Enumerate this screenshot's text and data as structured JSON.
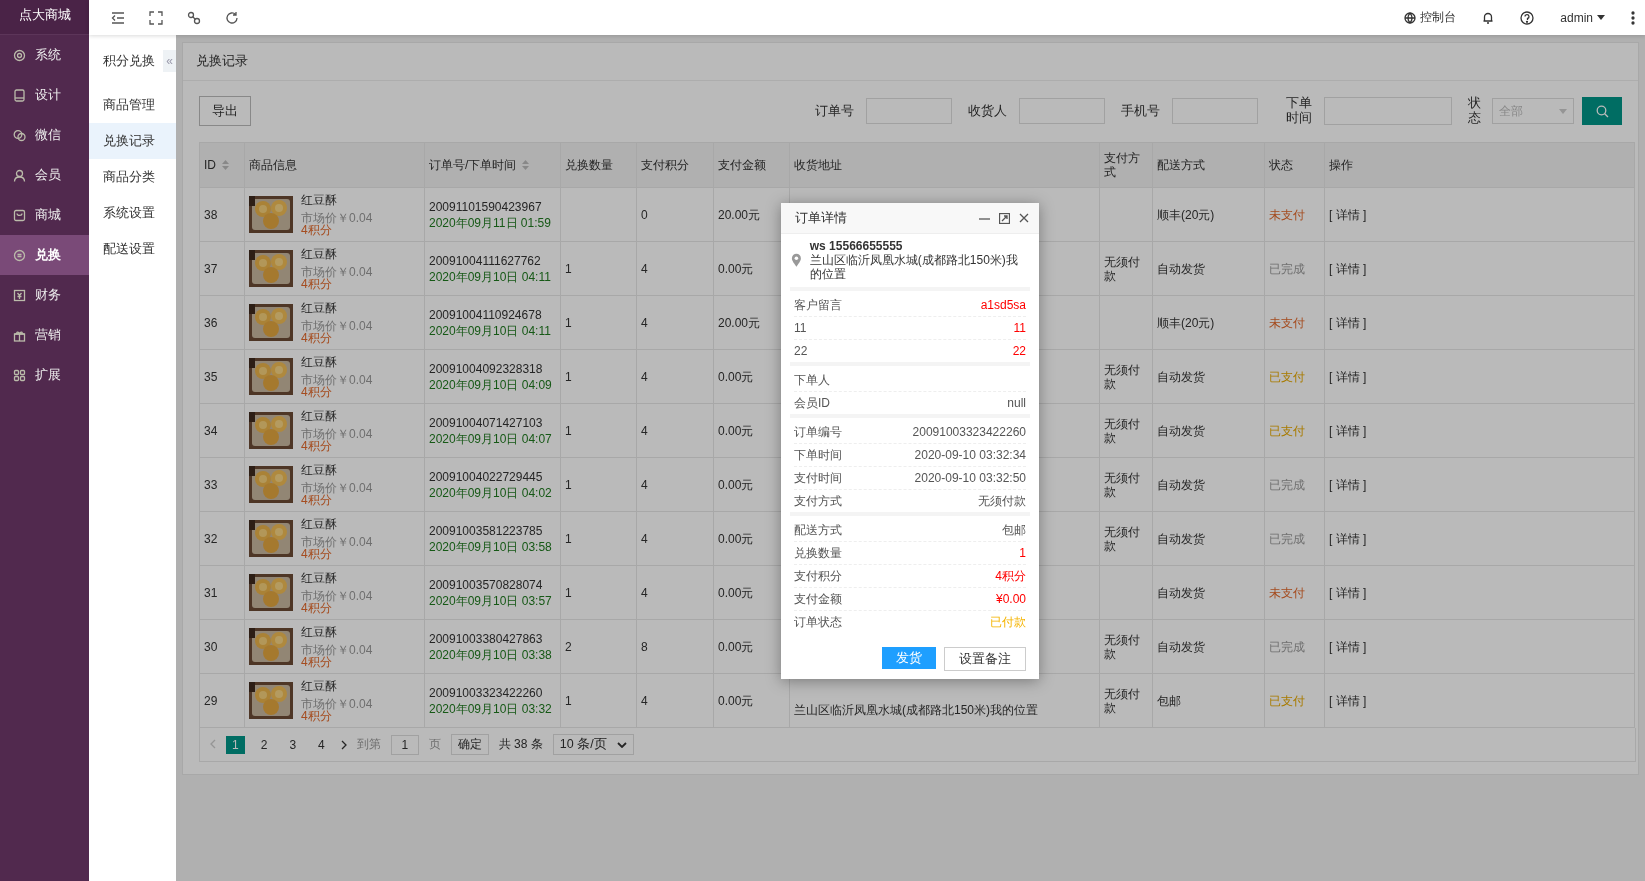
{
  "sidebar": {
    "logo": "点大商城",
    "items": [
      {
        "label": "系统",
        "selected": false
      },
      {
        "label": "设计",
        "selected": false
      },
      {
        "label": "微信",
        "selected": false
      },
      {
        "label": "会员",
        "selected": false
      },
      {
        "label": "商城",
        "selected": false
      },
      {
        "label": "兑换",
        "selected": true
      },
      {
        "label": "财务",
        "selected": false
      },
      {
        "label": "营销",
        "selected": false
      },
      {
        "label": "扩展",
        "selected": false
      }
    ]
  },
  "top_bar": {
    "console": "控制台",
    "user": "admin"
  },
  "subnav": {
    "title": "积分兑换",
    "collapse": "«",
    "items": [
      {
        "label": "商品管理",
        "selected": false
      },
      {
        "label": "兑换记录",
        "selected": true
      },
      {
        "label": "商品分类",
        "selected": false
      },
      {
        "label": "系统设置",
        "selected": false
      },
      {
        "label": "配送设置",
        "selected": false
      }
    ]
  },
  "panel": {
    "title": "兑换记录",
    "export": "导出",
    "filters": [
      {
        "label": "订单号",
        "kind": "text"
      },
      {
        "label": "收货人",
        "kind": "text"
      },
      {
        "label": "手机号",
        "kind": "text"
      },
      {
        "label": "下单时间",
        "kind": "date"
      },
      {
        "label": "状态",
        "kind": "select",
        "placeholder": "全部"
      }
    ]
  },
  "table": {
    "columns": [
      {
        "label": "ID",
        "sortable": true
      },
      {
        "label": "商品信息",
        "sortable": false
      },
      {
        "label": "订单号/下单时间",
        "sortable": true
      },
      {
        "label": "兑换数量",
        "sortable": false
      },
      {
        "label": "支付积分",
        "sortable": false
      },
      {
        "label": "支付金额",
        "sortable": false
      },
      {
        "label": "收货地址",
        "sortable": false
      },
      {
        "label": "支付方式",
        "sortable": false
      },
      {
        "label": "配送方式",
        "sortable": false
      },
      {
        "label": "状态",
        "sortable": false
      },
      {
        "label": "操作",
        "sortable": false
      }
    ],
    "rows": [
      {
        "id": "38",
        "product": "红豆酥",
        "market_price": "市场价￥0.04",
        "points": "4积分",
        "order_no": "20091101590423967",
        "time": "2020年09月11日 01:59",
        "quantity": "",
        "paid_points": "0",
        "amount": "20.00元",
        "address": "",
        "pay_method": "",
        "delivery": "顺丰(20元)",
        "status": "未支付",
        "kind": "unpaid",
        "action": "[ 详情 ]"
      },
      {
        "id": "37",
        "product": "红豆酥",
        "market_price": "市场价￥0.04",
        "points": "4积分",
        "order_no": "20091004111627762",
        "time": "2020年09月10日 04:11",
        "quantity": "1",
        "paid_points": "4",
        "amount": "0.00元",
        "address": "",
        "pay_method": "无须付款",
        "delivery": "自动发货",
        "status": "已完成",
        "kind": "done",
        "action": "[ 详情 ]"
      },
      {
        "id": "36",
        "product": "红豆酥",
        "market_price": "市场价￥0.04",
        "points": "4积分",
        "order_no": "20091004110924678",
        "time": "2020年09月10日 04:11",
        "quantity": "1",
        "paid_points": "4",
        "amount": "20.00元",
        "address": "",
        "pay_method": "",
        "delivery": "顺丰(20元)",
        "status": "未支付",
        "kind": "unpaid",
        "action": "[ 详情 ]"
      },
      {
        "id": "35",
        "product": "红豆酥",
        "market_price": "市场价￥0.04",
        "points": "4积分",
        "order_no": "20091004092328318",
        "time": "2020年09月10日 04:09",
        "quantity": "1",
        "paid_points": "4",
        "amount": "0.00元",
        "address": "",
        "pay_method": "无须付款",
        "delivery": "自动发货",
        "status": "已支付",
        "kind": "paid",
        "action": "[ 详情 ]"
      },
      {
        "id": "34",
        "product": "红豆酥",
        "market_price": "市场价￥0.04",
        "points": "4积分",
        "order_no": "20091004071427103",
        "time": "2020年09月10日 04:07",
        "quantity": "1",
        "paid_points": "4",
        "amount": "0.00元",
        "address": "",
        "pay_method": "无须付款",
        "delivery": "自动发货",
        "status": "已支付",
        "kind": "paid",
        "action": "[ 详情 ]"
      },
      {
        "id": "33",
        "product": "红豆酥",
        "market_price": "市场价￥0.04",
        "points": "4积分",
        "order_no": "20091004022729445",
        "time": "2020年09月10日 04:02",
        "quantity": "1",
        "paid_points": "4",
        "amount": "0.00元",
        "address": "",
        "pay_method": "无须付款",
        "delivery": "自动发货",
        "status": "已完成",
        "kind": "done",
        "action": "[ 详情 ]"
      },
      {
        "id": "32",
        "product": "红豆酥",
        "market_price": "市场价￥0.04",
        "points": "4积分",
        "order_no": "20091003581223785",
        "time": "2020年09月10日 03:58",
        "quantity": "1",
        "paid_points": "4",
        "amount": "0.00元",
        "address": "",
        "pay_method": "无须付款",
        "delivery": "自动发货",
        "status": "已完成",
        "kind": "done",
        "action": "[ 详情 ]"
      },
      {
        "id": "31",
        "product": "红豆酥",
        "market_price": "市场价￥0.04",
        "points": "4积分",
        "order_no": "20091003570828074",
        "time": "2020年09月10日 03:57",
        "quantity": "1",
        "paid_points": "4",
        "amount": "0.00元",
        "address": "",
        "pay_method": "",
        "delivery": "自动发货",
        "status": "未支付",
        "kind": "unpaid",
        "action": "[ 详情 ]"
      },
      {
        "id": "30",
        "product": "红豆酥",
        "market_price": "市场价￥0.04",
        "points": "4积分",
        "order_no": "20091003380427863",
        "time": "2020年09月10日 03:38",
        "quantity": "2",
        "paid_points": "8",
        "amount": "0.00元",
        "address": "",
        "pay_method": "无须付款",
        "delivery": "自动发货",
        "status": "已完成",
        "kind": "done",
        "action": "[ 详情 ]"
      },
      {
        "id": "29",
        "product": "红豆酥",
        "market_price": "市场价￥0.04",
        "points": "4积分",
        "order_no": "20091003323422260",
        "time": "2020年09月10日 03:32",
        "quantity": "1",
        "paid_points": "4",
        "amount": "0.00元",
        "address": "兰山区临沂凤凰水城(成都路北150米)我的位置",
        "pay_method": "无须付款",
        "delivery": "包邮",
        "status": "已支付",
        "kind": "paid",
        "action": "[ 详情 ]"
      }
    ]
  },
  "pagination": {
    "prev_disabled": true,
    "pages": [
      {
        "label": "1",
        "selected": true
      },
      {
        "label": "2",
        "selected": false
      },
      {
        "label": "3",
        "selected": false
      },
      {
        "label": "4",
        "selected": false
      }
    ],
    "goto": "到第",
    "page_value": "1",
    "page_unit": "页",
    "confirm": "确定",
    "total": "共 38 条",
    "page_size": "10 条/页"
  },
  "modal": {
    "title": "订单详情",
    "contact": "ws 15566655555",
    "address": "兰山区临沂凤凰水城(成都路北150米)我的位置",
    "sections": [
      [
        {
          "label": "客户留言",
          "value": "a1sd5sa",
          "kind": "alert"
        },
        {
          "label": "11",
          "value": "11",
          "kind": "alert"
        },
        {
          "label": "22",
          "value": "22",
          "kind": "alert"
        }
      ],
      [
        {
          "label": "下单人"
        },
        {
          "label": "会员ID",
          "value": "null",
          "kind": "plain"
        }
      ],
      [
        {
          "label": "订单编号",
          "value": "20091003323422260",
          "kind": "plain"
        },
        {
          "label": "下单时间",
          "value": "2020-09-10 03:32:34",
          "kind": "plain"
        },
        {
          "label": "支付时间",
          "value": "2020-09-10 03:32:50",
          "kind": "plain"
        },
        {
          "label": "支付方式",
          "value": "无须付款",
          "kind": "plain"
        }
      ],
      [
        {
          "label": "配送方式",
          "value": "包邮",
          "kind": "plain"
        },
        {
          "label": "兑换数量",
          "value": "1",
          "kind": "alert"
        },
        {
          "label": "支付积分",
          "value": "4积分",
          "kind": "alert"
        },
        {
          "label": "支付金额",
          "value": "¥0.00",
          "kind": "alert"
        },
        {
          "label": "订单状态",
          "value": "已付款",
          "kind": "warn"
        }
      ]
    ],
    "buttons": [
      {
        "label": "发货",
        "kind": "primary"
      },
      {
        "label": "设置备注",
        "kind": "default"
      }
    ]
  }
}
